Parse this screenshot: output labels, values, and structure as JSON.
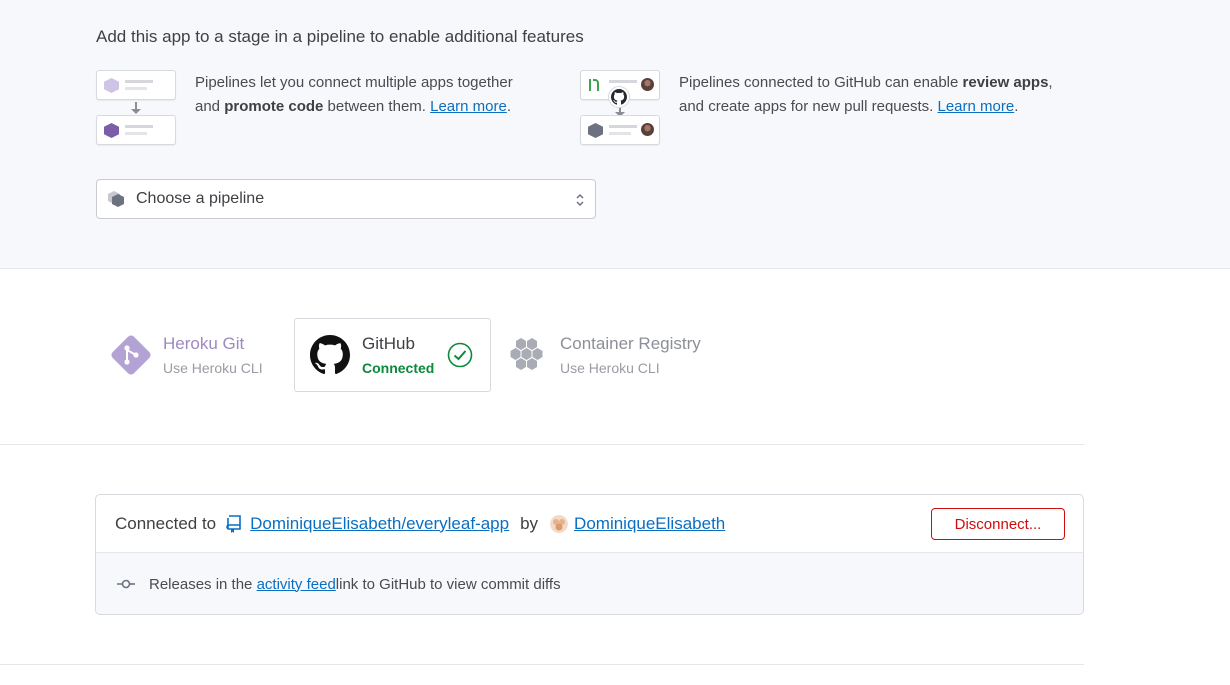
{
  "pipeline": {
    "heading": "Add this app to a stage in a pipeline to enable additional features",
    "feature1": {
      "text_a": "Pipelines let you connect multiple apps together and ",
      "bold": "promote code",
      "text_b": " between them. ",
      "link": "Learn more",
      "end": "."
    },
    "feature2": {
      "text_a": "Pipelines connected to GitHub can enable ",
      "bold": "review apps",
      "text_b": ", and create apps for new pull requests. ",
      "link": "Learn more",
      "end": "."
    },
    "select_placeholder": "Choose a pipeline"
  },
  "deployment_methods": [
    {
      "title": "Heroku Git",
      "subtitle": "Use Heroku CLI",
      "icon": "heroku-git-icon",
      "color": "#9d8ac0"
    },
    {
      "title": "GitHub",
      "subtitle": "Connected",
      "icon": "github-icon",
      "status_color": "#0a8a3a"
    },
    {
      "title": "Container Registry",
      "subtitle": "Use Heroku CLI",
      "icon": "container-registry-icon"
    }
  ],
  "connection": {
    "prefix": "Connected to",
    "repo": "DominiqueElisabeth/everyleaf-app",
    "by": "by",
    "user": "DominiqueElisabeth",
    "disconnect_label": "Disconnect...",
    "releases_text_a": "Releases in the ",
    "releases_link": "activity feed",
    "releases_text_b": " link to GitHub to view commit diffs"
  },
  "colors": {
    "link": "#0a6fc2",
    "danger": "#cf0d0d",
    "success": "#0a8a3a",
    "heroku_purple": "#9d8ac0"
  }
}
